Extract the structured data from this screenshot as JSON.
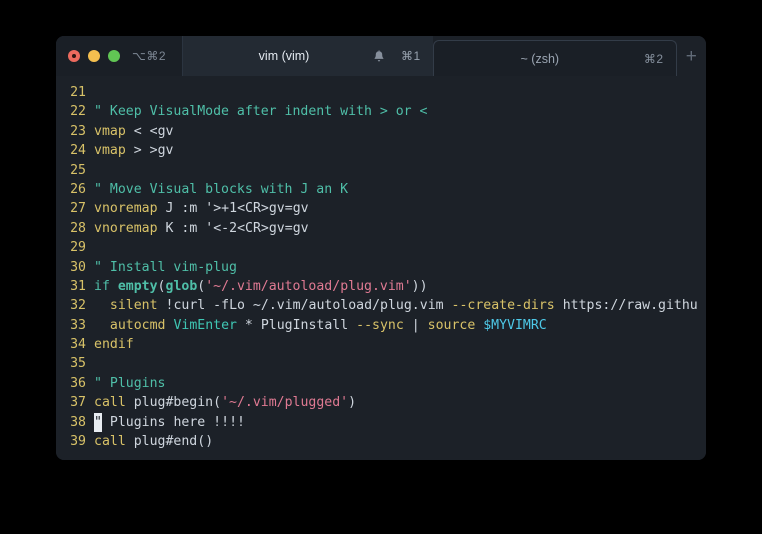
{
  "window": {
    "traffic_lights": [
      {
        "name": "close",
        "color": "#ec6a5e"
      },
      {
        "name": "minimize",
        "color": "#f4bf4f"
      },
      {
        "name": "zoom",
        "color": "#61c554"
      }
    ],
    "left_shortcut": "⌥⌘2"
  },
  "tabs": [
    {
      "id": "vim",
      "title": "vim (vim)",
      "shortcut": "⌘1",
      "active": true,
      "has_bell": true
    },
    {
      "id": "zsh",
      "title": "~ (zsh)",
      "shortcut": "⌘2",
      "active": false,
      "has_bell": false
    }
  ],
  "new_tab_label": "+",
  "editor": {
    "first_line": 21,
    "last_line": 39,
    "cursor": {
      "line": 38,
      "column": 1,
      "char": "\""
    },
    "lines": [
      {
        "n": "21",
        "text": ""
      },
      {
        "n": "22",
        "text": "\" Keep VisualMode after indent with > or <"
      },
      {
        "n": "23",
        "text": "vmap < <gv"
      },
      {
        "n": "24",
        "text": "vmap > >gv"
      },
      {
        "n": "25",
        "text": ""
      },
      {
        "n": "26",
        "text": "\" Move Visual blocks with J an K"
      },
      {
        "n": "27",
        "text": "vnoremap J :m '>+1<CR>gv=gv"
      },
      {
        "n": "28",
        "text": "vnoremap K :m '<-2<CR>gv=gv"
      },
      {
        "n": "29",
        "text": ""
      },
      {
        "n": "30",
        "text": "\" Install vim-plug"
      },
      {
        "n": "31",
        "text": "if empty(glob('~/.vim/autoload/plug.vim'))"
      },
      {
        "n": "32",
        "text": "  silent !curl -fLo ~/.vim/autoload/plug.vim --create-dirs https://raw.githu"
      },
      {
        "n": "33",
        "text": "  autocmd VimEnter * PlugInstall --sync | source $MYVIMRC"
      },
      {
        "n": "34",
        "text": "endif"
      },
      {
        "n": "35",
        "text": ""
      },
      {
        "n": "36",
        "text": "\" Plugins"
      },
      {
        "n": "37",
        "text": "call plug#begin('~/.vim/plugged')"
      },
      {
        "n": "38",
        "text": "\" Plugins here !!!!"
      },
      {
        "n": "39",
        "text": "call plug#end()"
      }
    ]
  },
  "colors": {
    "window_bg": "#1c2128",
    "tab_active_bg": "#232a33",
    "tab_inactive_bg": "#1a1f26",
    "desktop_bg": "#000000",
    "lineno": "#d8c268",
    "comment": "#4fbfa8",
    "keyword": "#d8c268",
    "string": "#e07a93",
    "function": "#4fbfa8",
    "variable": "#4ec9e8",
    "text": "#cfd6de"
  }
}
